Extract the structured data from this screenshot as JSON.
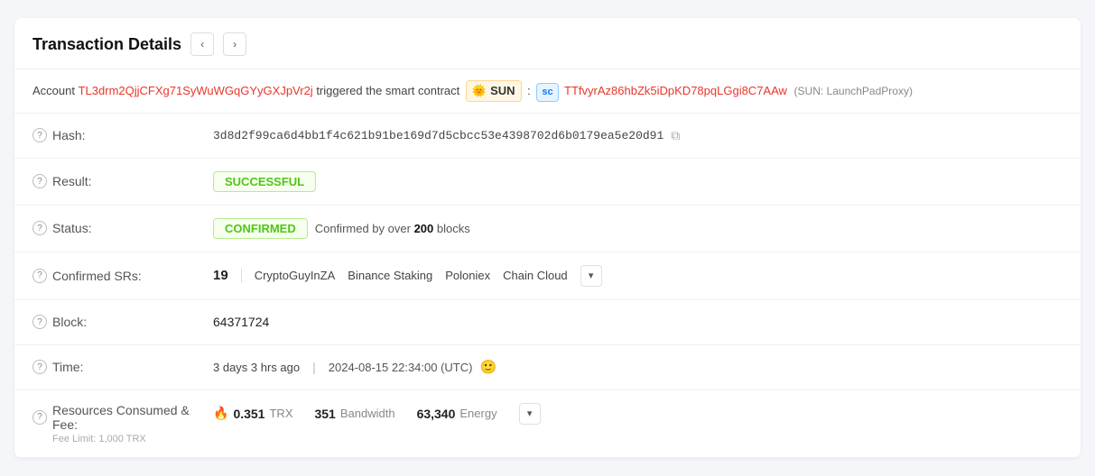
{
  "header": {
    "title": "Transaction Details",
    "prev_label": "‹",
    "next_label": "›"
  },
  "account_row": {
    "prefix": "Account",
    "account_address": "TL3drm2QjjCFXg71SyWuWGqGYyGXJpVr2j",
    "middle": "triggered the smart contract",
    "sun_emoji": "🌞",
    "sun_label": "SUN",
    "sc_label": "sc",
    "contract_address": "TTfvyrAz86hbZk5iDpKD78pqLGgi8C7AAw",
    "proxy_text": "(SUN: LaunchPadProxy)"
  },
  "details": {
    "hash": {
      "label": "Hash:",
      "value": "3d8d2f99ca6d4bb1f4c621b91be169d7d5cbcc53e4398702d6b0179ea5e20d91",
      "copy_icon": "⧉"
    },
    "result": {
      "label": "Result:",
      "value": "SUCCESSFUL"
    },
    "status": {
      "label": "Status:",
      "badge": "CONFIRMED",
      "description": "Confirmed by over",
      "blocks_count": "200",
      "blocks_label": "blocks"
    },
    "confirmed_srs": {
      "label": "Confirmed SRs:",
      "count": "19",
      "items": [
        "CryptoGuyInZA",
        "Binance Staking",
        "Poloniex",
        "Chain Cloud"
      ]
    },
    "block": {
      "label": "Block:",
      "value": "64371724"
    },
    "time": {
      "label": "Time:",
      "relative": "3 days 3 hrs ago",
      "separator": "|",
      "utc": "2024-08-15 22:34:00 (UTC)"
    },
    "resources": {
      "label": "Resources Consumed & Fee:",
      "sublabel": "Fee Limit: 1,000 TRX",
      "trx_amount": "0.351",
      "trx_unit": "TRX",
      "bandwidth_amount": "351",
      "bandwidth_unit": "Bandwidth",
      "energy_amount": "63,340",
      "energy_unit": "Energy"
    }
  },
  "icons": {
    "question": "?",
    "copy": "⧉",
    "chevron_down": "▾",
    "fire": "🔥",
    "smiley": "🙂"
  }
}
